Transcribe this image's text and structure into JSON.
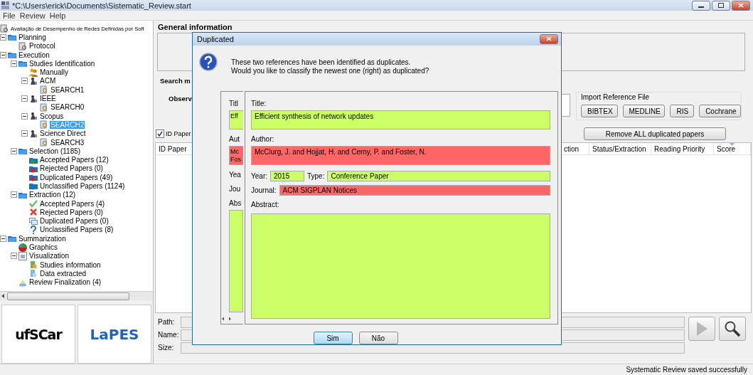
{
  "window": {
    "title": "*C:\\Users\\erick\\Documents\\Sistematic_Review.start"
  },
  "menu": [
    "File",
    "Review",
    "Help"
  ],
  "tree": {
    "label": "Avaliação de Desempenho de Redes Definidas por Soft",
    "kind": "protocol",
    "selected": false,
    "children": [
      {
        "label": "Planning",
        "kind": "folder",
        "expanded": true,
        "selected": false,
        "children": [
          {
            "label": "Protocol",
            "kind": "protocol",
            "selected": false
          }
        ]
      },
      {
        "label": "Execution",
        "kind": "folder",
        "expanded": true,
        "selected": false,
        "children": [
          {
            "label": "Studies Identification",
            "kind": "folder",
            "expanded": true,
            "selected": false,
            "children": [
              {
                "label": "Manually",
                "kind": "users",
                "selected": false
              },
              {
                "label": "ACM",
                "kind": "library",
                "expanded": true,
                "selected": false,
                "children": [
                  {
                    "label": "SEARCH1",
                    "kind": "search",
                    "selected": false
                  }
                ]
              },
              {
                "label": "IEEE",
                "kind": "library",
                "expanded": true,
                "selected": false,
                "children": [
                  {
                    "label": "SEARCH0",
                    "kind": "search",
                    "selected": false
                  }
                ]
              },
              {
                "label": "Scopus",
                "kind": "library",
                "expanded": true,
                "selected": false,
                "children": [
                  {
                    "label": "SEARCH2",
                    "kind": "search",
                    "selected": true
                  }
                ]
              },
              {
                "label": "Science Direct",
                "kind": "library",
                "expanded": true,
                "selected": false,
                "children": [
                  {
                    "label": "SEARCH3",
                    "kind": "search",
                    "selected": false
                  }
                ]
              }
            ]
          },
          {
            "label": "Selection (1185)",
            "kind": "folder",
            "expanded": true,
            "selected": false,
            "children": [
              {
                "label": "Accepted Papers (12)",
                "kind": "folder_ok",
                "selected": false
              },
              {
                "label": "Rejected Papers (0)",
                "kind": "folder_bad",
                "selected": false
              },
              {
                "label": "Duplicated Papers (49)",
                "kind": "folder_bad",
                "selected": false
              },
              {
                "label": "Unclassified Papers (1124)",
                "kind": "folder_new",
                "selected": false
              }
            ]
          },
          {
            "label": "Extraction (12)",
            "kind": "folder",
            "expanded": true,
            "selected": false,
            "children": [
              {
                "label": "Accepted Papers (4)",
                "kind": "check",
                "selected": false
              },
              {
                "label": "Rejected Papers (0)",
                "kind": "cross",
                "selected": false
              },
              {
                "label": "Duplicated Papers (0)",
                "kind": "windows",
                "selected": false
              },
              {
                "label": "Unclassified Papers (8)",
                "kind": "question",
                "selected": false
              }
            ]
          }
        ]
      },
      {
        "label": "Summarization",
        "kind": "folder",
        "expanded": true,
        "selected": false,
        "children": [
          {
            "label": "Graphics",
            "kind": "pie",
            "selected": false
          },
          {
            "label": "Visualization",
            "kind": "monitor",
            "expanded": true,
            "selected": false,
            "children": [
              {
                "label": "Studies information",
                "kind": "sheet_green",
                "selected": false
              },
              {
                "label": "Data extracted",
                "kind": "sheet_blue",
                "selected": false
              }
            ]
          },
          {
            "label": "Review Finalization (4)",
            "kind": "finalization",
            "selected": false
          }
        ]
      }
    ]
  },
  "logos": [
    "ufSCar",
    "LaPES"
  ],
  "general_information": {
    "title": "General information",
    "search_label": "Search m",
    "observation_label": "Observ"
  },
  "import_reference_file": {
    "title": "Import Reference File",
    "buttons": [
      "BIBTEX",
      "MEDLINE",
      "RIS",
      "Cochrane"
    ]
  },
  "id_paper_checkbox": {
    "label": "ID Paper",
    "checked": true
  },
  "remove_button": "Remove ALL duplicated papers",
  "table": {
    "columns": [
      {
        "label": "ID Paper",
        "sorted": false
      },
      {
        "label": "ction",
        "sorted": false
      },
      {
        "label": "Status/Extraction",
        "sorted": false
      },
      {
        "label": "Reading Priority",
        "sorted": false
      },
      {
        "label": "Score",
        "sorted": true
      }
    ]
  },
  "file_fields": [
    {
      "label": "Path:"
    },
    {
      "label": "Name:"
    },
    {
      "label": "Size:"
    }
  ],
  "status_bar": "Systematic Review saved successfully",
  "dialog": {
    "title": "Duplicated",
    "message": "These two references have been identified as duplicates.\nWould you like to classify the newest one (right) as duplicated?",
    "left_reference": [
      {
        "kind": "block",
        "label": "Titl",
        "value": "Eff",
        "match": true
      },
      {
        "kind": "block",
        "label": "Aut",
        "value": "Mc\nFos",
        "match": false
      },
      {
        "kind": "label",
        "label": "Yea"
      },
      {
        "kind": "label",
        "label": "Jou"
      },
      {
        "kind": "area",
        "label": "Abs",
        "match": true
      }
    ],
    "right_reference": [
      {
        "kind": "block",
        "label": "Title:",
        "value": "Efficient synthesis of network updates",
        "match": true
      },
      {
        "kind": "block",
        "label": "Author:",
        "value": "McClurg, J. and Hojjat, H. and Cerny, P. and Foster, N.",
        "match": false
      },
      {
        "kind": "inline",
        "items": [
          {
            "label": "Year:",
            "value": "2015",
            "match": true
          },
          {
            "label": "Type:",
            "value": "Conference Paper",
            "match": true
          }
        ]
      },
      {
        "kind": "inline",
        "items": [
          {
            "label": "Journal:",
            "value": "ACM SIGPLAN Notices",
            "match": false
          }
        ]
      },
      {
        "kind": "area",
        "label": "Abstract:",
        "match": true
      }
    ],
    "buttons": [
      {
        "label": "Sim",
        "default": true
      },
      {
        "label": "Não",
        "default": false
      }
    ]
  }
}
